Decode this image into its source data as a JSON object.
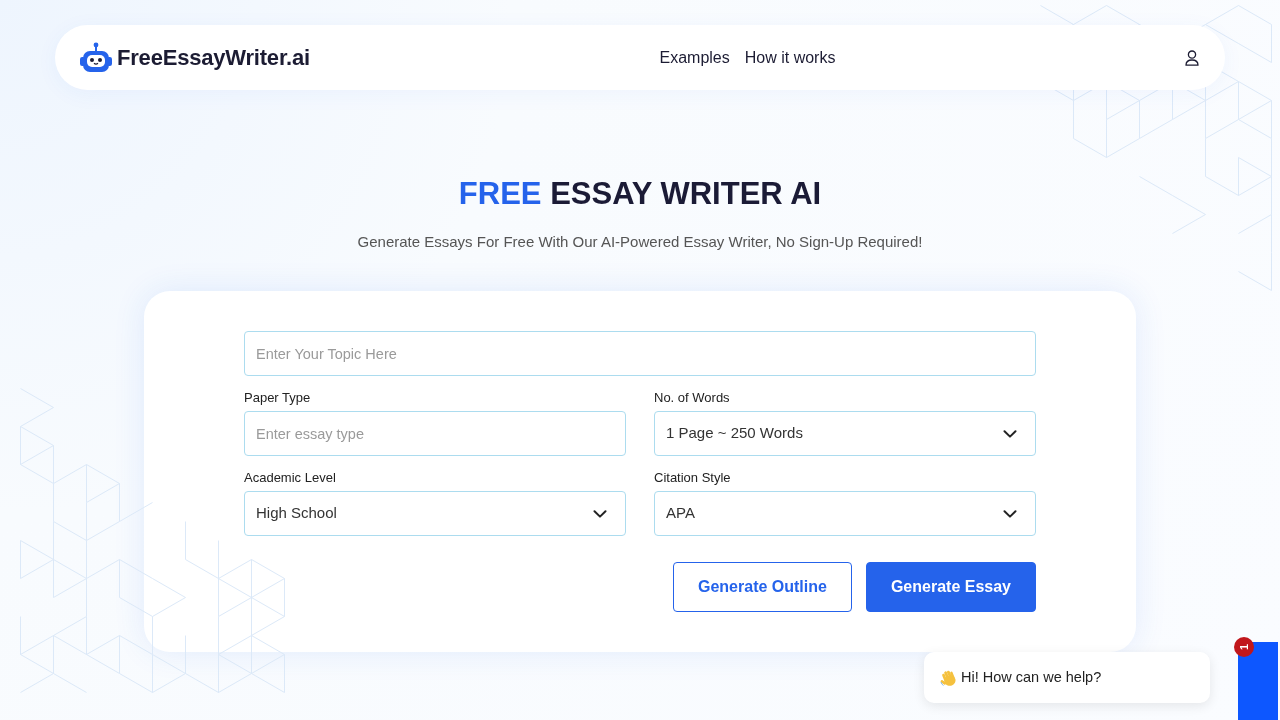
{
  "header": {
    "logo_text": "FreeEssayWriter.ai",
    "nav_links": [
      "Examples",
      "How it works"
    ]
  },
  "hero": {
    "title_accent": "FREE",
    "title_rest": "ESSAY WRITER AI",
    "subtitle": "Generate Essays For Free With Our AI-Powered Essay Writer, No Sign-Up Required!"
  },
  "form": {
    "topic": {
      "placeholder": "Enter Your Topic Here"
    },
    "fields": [
      {
        "label": "Paper Type",
        "kind": "input",
        "placeholder": "Enter essay type"
      },
      {
        "label": "No. of Words",
        "kind": "select",
        "value": "1 Page ~ 250 Words"
      },
      {
        "label": "Academic Level",
        "kind": "select",
        "value": "High School"
      },
      {
        "label": "Citation Style",
        "kind": "select",
        "value": "APA"
      }
    ],
    "buttons": [
      {
        "label": "Generate Outline",
        "kind": "outline"
      },
      {
        "label": "Generate Essay",
        "kind": "primary"
      }
    ]
  },
  "chat": {
    "greeting": "Hi! How can we help?",
    "badge": "1"
  }
}
